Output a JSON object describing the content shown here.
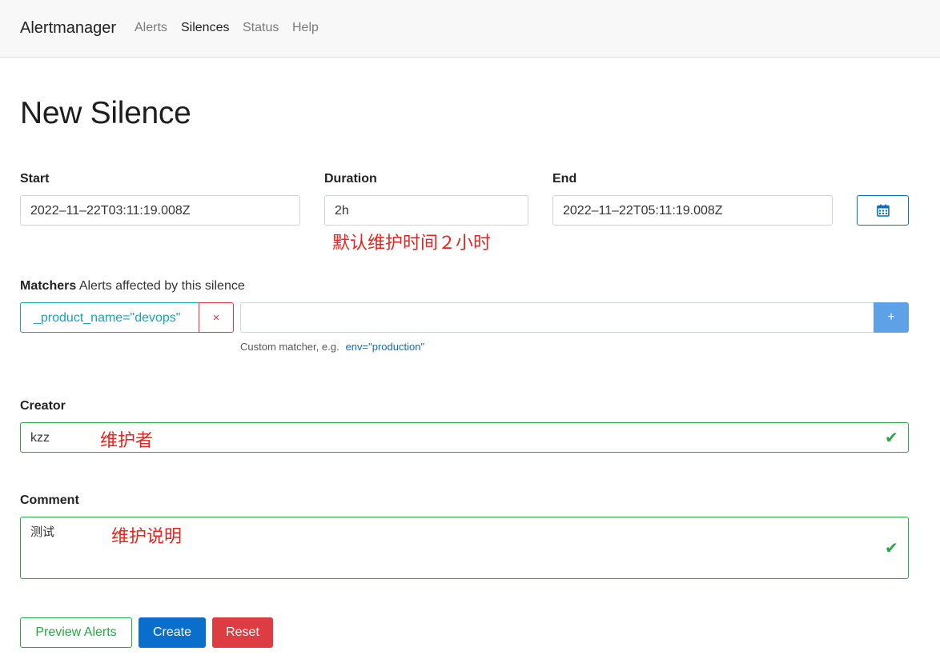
{
  "app": {
    "brand": "Alertmanager"
  },
  "nav": {
    "items": [
      {
        "label": "Alerts"
      },
      {
        "label": "Silences"
      },
      {
        "label": "Status"
      },
      {
        "label": "Help"
      }
    ]
  },
  "page": {
    "title": "New Silence"
  },
  "form": {
    "start": {
      "label": "Start",
      "value": "2022–11–22T03:11:19.008Z"
    },
    "duration": {
      "label": "Duration",
      "value": "2h"
    },
    "end": {
      "label": "End",
      "value": "2022–11–22T05:11:19.008Z"
    },
    "calendar_icon": "calendar-icon",
    "matchers": {
      "label": "Matchers",
      "description": "Alerts affected by this silence",
      "items": [
        {
          "text": "_product_name=\"devops\""
        }
      ],
      "remove_symbol": "×",
      "add_symbol": "+",
      "new_matcher_value": "",
      "help_text": "Custom matcher, e.g.",
      "help_example": "env=\"production\""
    },
    "creator": {
      "label": "Creator",
      "value": "kzz"
    },
    "comment": {
      "label": "Comment",
      "value": "测试"
    },
    "valid_mark": "✔"
  },
  "annotations": {
    "duration_note": "默认维护时间２小时",
    "creator_note": "维护者",
    "comment_note": "维护说明"
  },
  "actions": {
    "preview": "Preview Alerts",
    "create": "Create",
    "reset": "Reset"
  },
  "colors": {
    "primary": "#0a6ecc",
    "success": "#28a745",
    "danger": "#dc3545",
    "info": "#17a2b8",
    "annotation": "#e8231d"
  }
}
